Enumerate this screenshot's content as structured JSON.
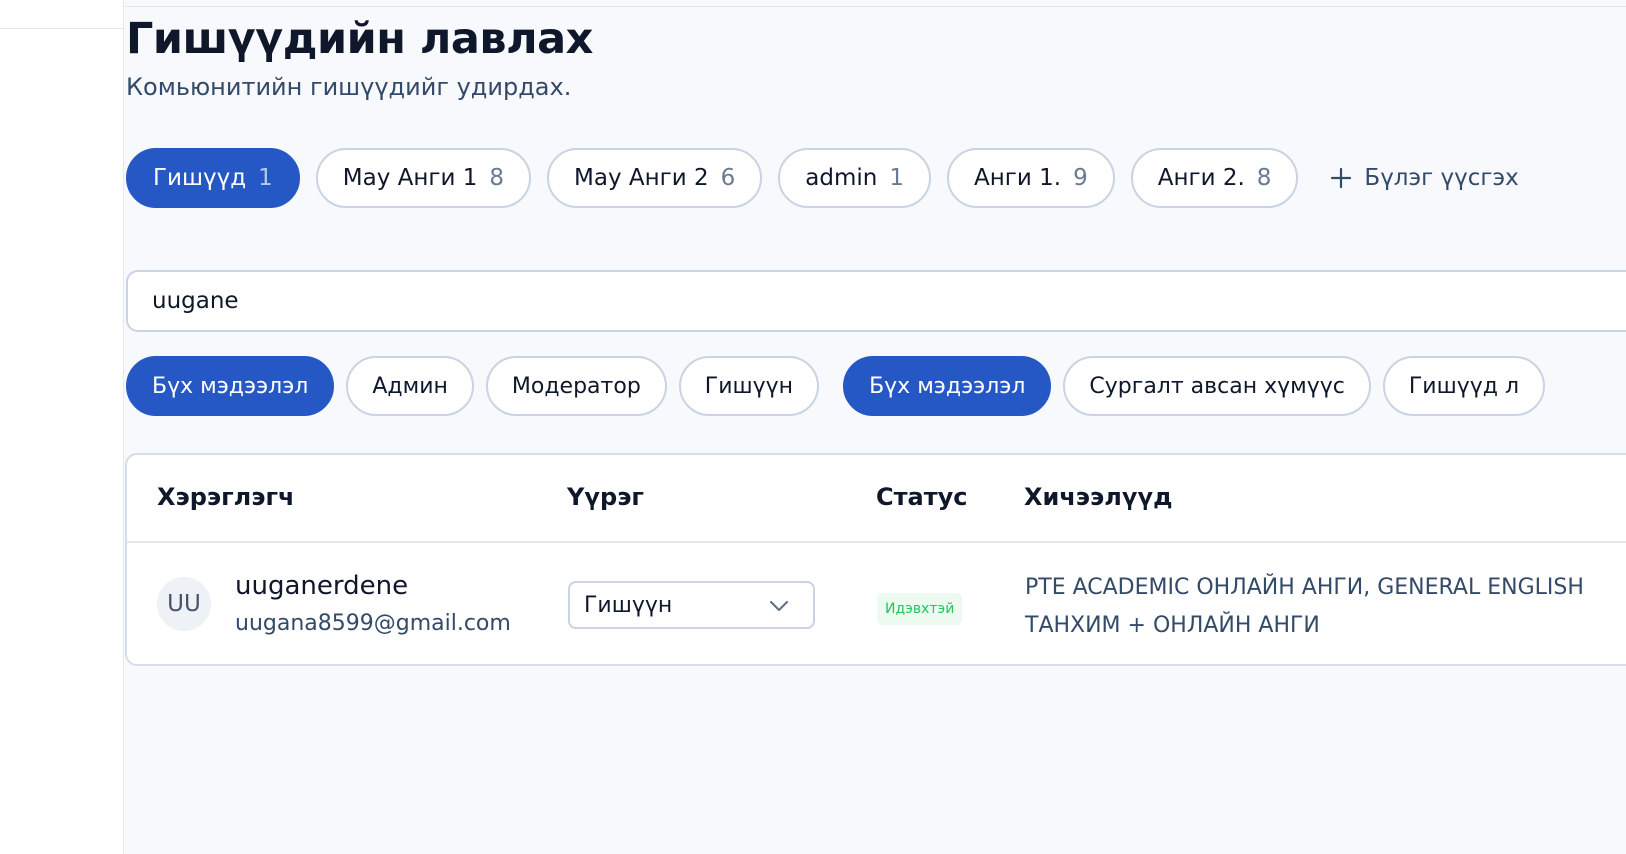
{
  "page": {
    "title": "Гишүүдийн лавлах",
    "subtitle": "Комьюнитийн гишүүдийг удирдах."
  },
  "groups": [
    {
      "label": "Гишүүд",
      "count": "1",
      "active": true
    },
    {
      "label": "May Анги 1",
      "count": "8",
      "active": false
    },
    {
      "label": "May Анги 2",
      "count": "6",
      "active": false
    },
    {
      "label": "admin",
      "count": "1",
      "active": false
    },
    {
      "label": "Анги 1.",
      "count": "9",
      "active": false
    },
    {
      "label": "Анги 2.",
      "count": "8",
      "active": false
    }
  ],
  "add_group_label": "Бүлэг үүсгэх",
  "search": {
    "value": "uugane"
  },
  "role_filters": [
    {
      "label": "Бүх мэдээлэл",
      "active": true
    },
    {
      "label": "Админ",
      "active": false
    },
    {
      "label": "Модератор",
      "active": false
    },
    {
      "label": "Гишүүн",
      "active": false
    }
  ],
  "type_filters": [
    {
      "label": "Бүх мэдээлэл",
      "active": true
    },
    {
      "label": "Сургалт авсан хүмүүс",
      "active": false
    },
    {
      "label": "Гишүүд л",
      "active": false
    }
  ],
  "table": {
    "columns": {
      "user": "Хэрэглэгч",
      "role": "Үүрэг",
      "status": "Статус",
      "courses": "Хичээлүүд"
    },
    "rows": [
      {
        "initials": "UU",
        "name": "uuganerdene",
        "email": "uugana8599@gmail.com",
        "role": "Гишүүн",
        "status": "Идэвхтэй",
        "courses": "PTE ACADEMIC ОНЛАЙН АНГИ, GENERAL ENGLISH ТАНХИМ + ОНЛАЙН АНГИ"
      }
    ]
  },
  "colors": {
    "accent": "#2558c4",
    "status_active_text": "#22c55e",
    "status_active_bg": "#ecfaf0"
  }
}
